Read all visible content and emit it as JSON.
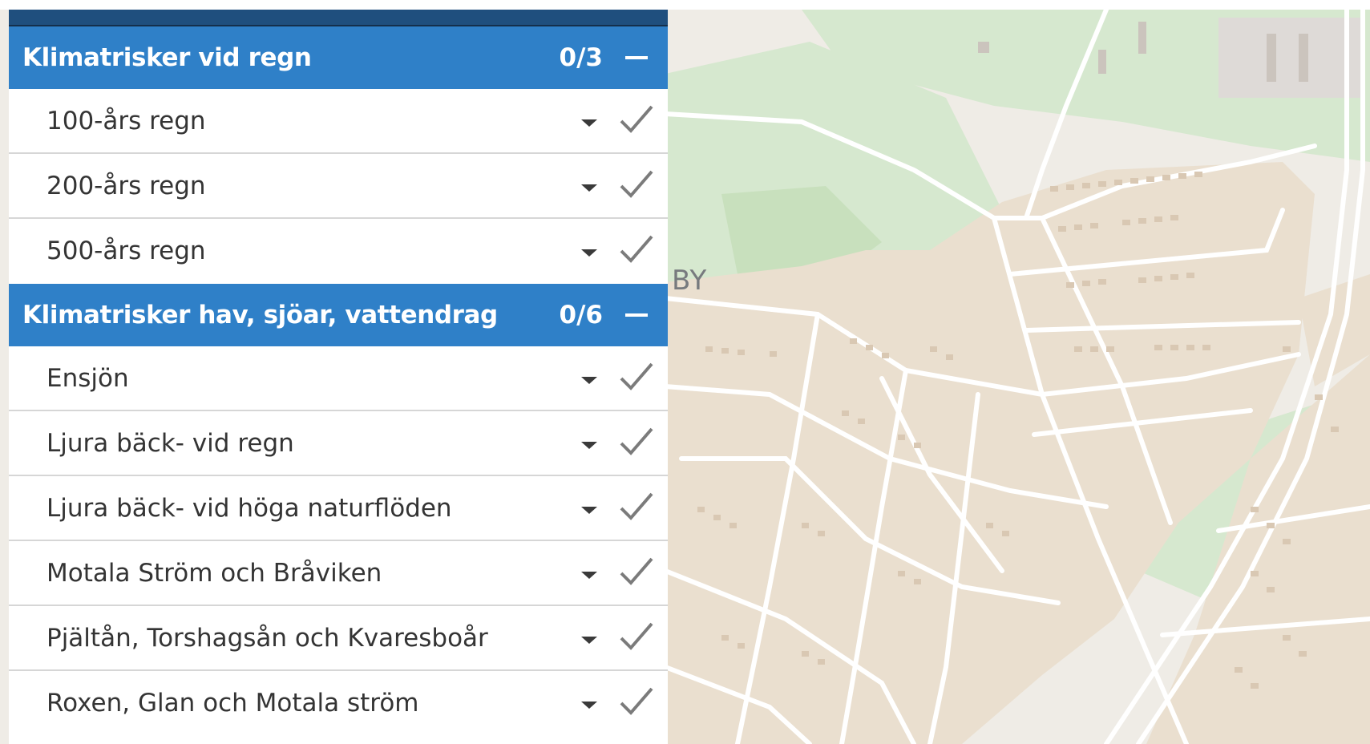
{
  "map": {
    "place_label": "BY",
    "colors": {
      "base": "#efece6",
      "residential": "#eadfcf",
      "park": "#d6e8cf",
      "park_dark": "#c8e0bd",
      "road": "#ffffff",
      "building": "#d9c8b3",
      "industrial": "#dedad7"
    }
  },
  "panel": {
    "groups": [
      {
        "title": "Klimatrisker vid regn",
        "count": "0/3",
        "layers": [
          {
            "name": "100-års regn"
          },
          {
            "name": "200-års regn"
          },
          {
            "name": "500-års regn"
          }
        ]
      },
      {
        "title": "Klimatrisker hav, sjöar, vattendrag",
        "count": "0/6",
        "layers": [
          {
            "name": "Ensjön"
          },
          {
            "name": "Ljura bäck- vid regn"
          },
          {
            "name": "Ljura bäck- vid höga naturflöden"
          },
          {
            "name": "Motala Ström och Bråviken"
          },
          {
            "name": "Pjältån, Torshagsån och Kvaresboår"
          },
          {
            "name": "Roxen, Glan och Motala ström"
          }
        ]
      }
    ],
    "icons": {
      "collapse": "minus-icon",
      "dropdown": "chevron-down-icon",
      "visibility": "check-icon"
    },
    "colors": {
      "header": "#2f80c8",
      "topbar": "#1f4f7e",
      "text": "#343434",
      "divider": "#d6d6d6"
    }
  }
}
